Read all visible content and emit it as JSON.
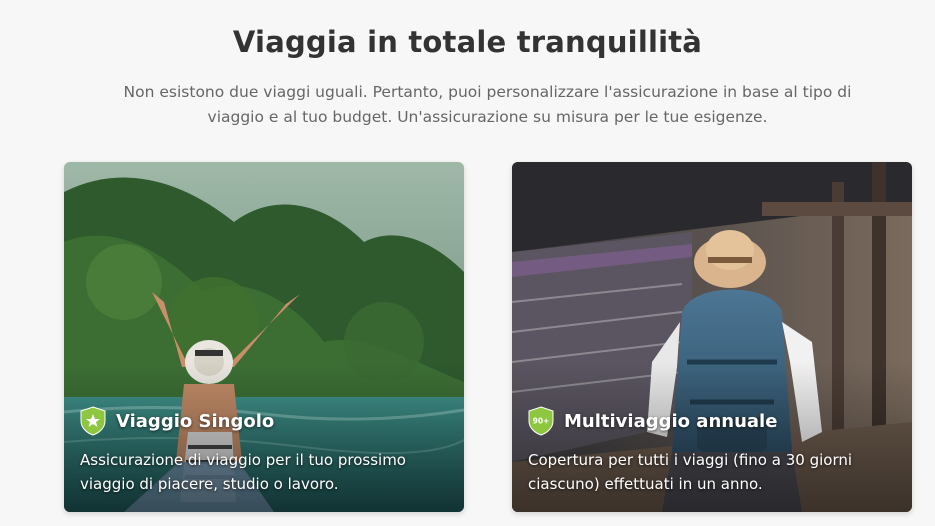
{
  "header": {
    "title": "Viaggia in totale tranquillità",
    "subtitle": "Non esistono due viaggi uguali. Pertanto, puoi personalizzare l'assicurazione in base al tipo di viaggio e al tuo budget. Un'assicurazione su misura per le tue esigenze."
  },
  "cards": [
    {
      "title": "Viaggio Singolo",
      "description": "Assicurazione di viaggio per il tuo prossimo viaggio di piacere, studio o lavoro.",
      "icon": "star-shield-icon"
    },
    {
      "title": "Multiviaggio annuale",
      "description": "Copertura per tutti i viaggi (fino a 30 giorni ciascuno) effettuati in un anno.",
      "icon": "90-days-shield-icon",
      "badge_text": "90+"
    }
  ],
  "colors": {
    "badge_green": "#8dc63f",
    "title_text": "#333333",
    "subtitle_text": "#666666"
  }
}
